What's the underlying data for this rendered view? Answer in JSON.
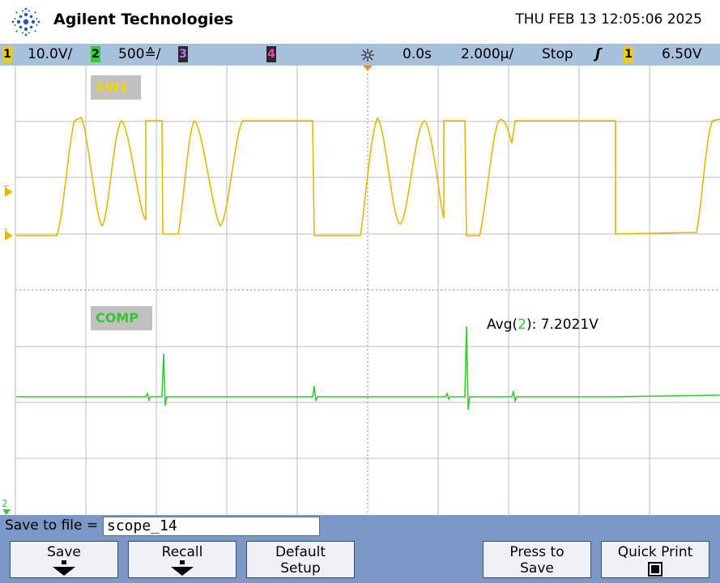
{
  "header": {
    "brand": "Agilent Technologies",
    "datetime": "THU FEB 13 12:05:06 2025",
    "logo_icon": "agilent-spark-icon"
  },
  "status_bar": {
    "ch1": {
      "num": "1",
      "scale": "10.0V/",
      "color": "#f2d000"
    },
    "ch2": {
      "num": "2",
      "scale": "500≙/",
      "color": "#33cc33"
    },
    "ch3": {
      "num": "3",
      "color": "#c070ff"
    },
    "ch4": {
      "num": "4",
      "color": "#ff3fb0"
    },
    "acq_icon": "acquisition-spark-icon",
    "time_delay": "0.0s",
    "time_scale": "2.000µ/",
    "run_state": "Stop",
    "trigger_slope": "ʃ",
    "trigger_ch": "1",
    "trigger_level": "6.50V"
  },
  "screen": {
    "traces": [
      {
        "name": "SW1",
        "color": "#e6b800",
        "label_color": "#f5d400"
      },
      {
        "name": "COMP",
        "color": "#33cc33",
        "label_color": "#35c435"
      }
    ],
    "markers": {
      "trigger": "T",
      "ch1": "1",
      "ch2": "2"
    },
    "measurement": {
      "prefix": "Avg(",
      "ch": "2",
      "suffix": "): 7.2021V"
    }
  },
  "bottom": {
    "save_to_file_label": "Save to file =",
    "filename": "scope_14",
    "softkeys": {
      "save": "Save",
      "recall": "Recall",
      "default_1": "Default",
      "default_2": "Setup",
      "press_1": "Press to",
      "press_2": "Save",
      "quick_print": "Quick Print"
    }
  }
}
